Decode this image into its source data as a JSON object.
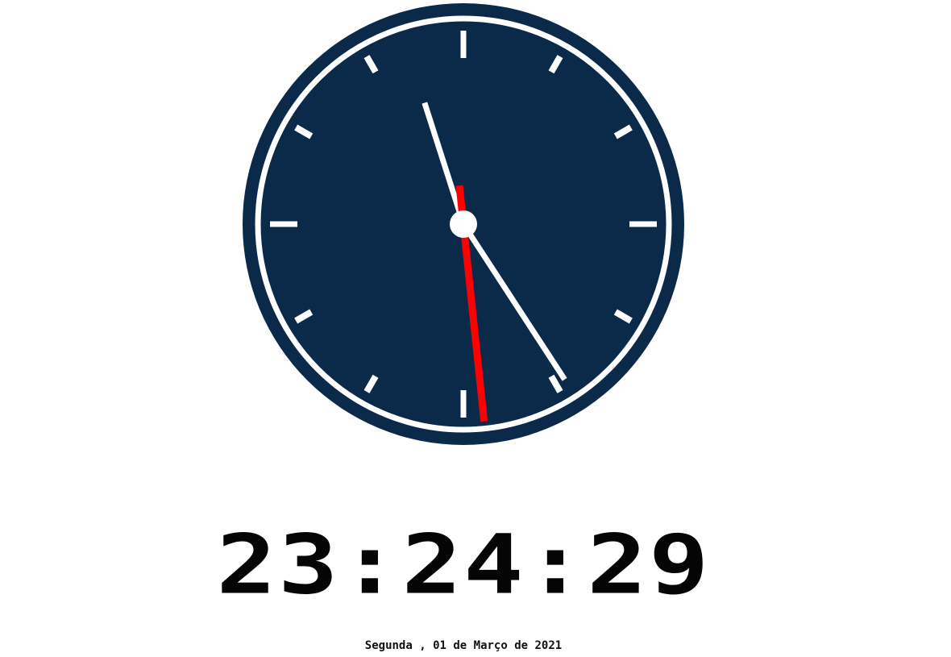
{
  "clock": {
    "hours": 23,
    "minutes": 24,
    "seconds": 29,
    "colors": {
      "face": "#0b2a4a",
      "ring": "#ffffff",
      "marks": "#ffffff",
      "hour_hand": "#ffffff",
      "minute_hand": "#ffffff",
      "second_hand": "#ff0000",
      "center_dot": "#ffffff"
    }
  },
  "digital": {
    "time_text": "23:24:29"
  },
  "date": {
    "text": "Segunda , 01 de Março de 2021"
  }
}
